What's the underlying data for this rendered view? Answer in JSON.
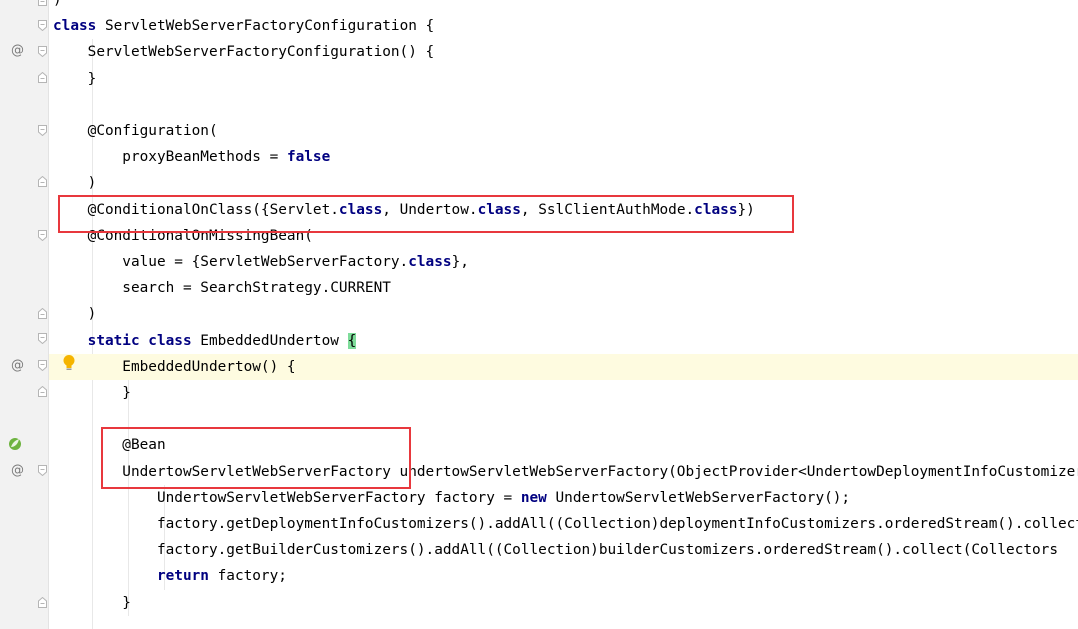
{
  "colors": {
    "keyword": "#000080",
    "highlight_box": "#e8383d",
    "current_line": "#fefbe0",
    "brace_match": "#7edc9a"
  },
  "gutter_icons": {
    "override": "@",
    "implements": "@",
    "bulb": "bulb-icon",
    "spring": "spring-bean-icon",
    "fold": "fold-icon"
  },
  "lines": [
    {
      "top_code": [
        {
          "t": ")",
          "c": "plain"
        }
      ]
    },
    {
      "code": [
        {
          "t": "class",
          "c": "kw"
        },
        {
          "t": " ServletWebServerFactoryConfiguration {",
          "c": "plain"
        }
      ]
    },
    {
      "code": [
        {
          "t": "    ServletWebServerFactoryConfiguration() {",
          "c": "plain"
        }
      ]
    },
    {
      "code": [
        {
          "t": "    }",
          "c": "plain"
        }
      ]
    },
    {
      "code": [
        {
          "t": "",
          "c": "plain"
        }
      ]
    },
    {
      "code": [
        {
          "t": "    @Configuration(",
          "c": "plain"
        }
      ]
    },
    {
      "code": [
        {
          "t": "        proxyBeanMethods = ",
          "c": "plain"
        },
        {
          "t": "false",
          "c": "kw"
        }
      ]
    },
    {
      "code": [
        {
          "t": "    )",
          "c": "plain"
        }
      ]
    },
    {
      "code": [
        {
          "t": "    @ConditionalOnClass({Servlet.",
          "c": "plain"
        },
        {
          "t": "class",
          "c": "kw"
        },
        {
          "t": ", Undertow.",
          "c": "plain"
        },
        {
          "t": "class",
          "c": "kw"
        },
        {
          "t": ", SslClientAuthMode.",
          "c": "plain"
        },
        {
          "t": "class",
          "c": "kw"
        },
        {
          "t": "})",
          "c": "plain"
        }
      ]
    },
    {
      "code": [
        {
          "t": "    @ConditionalOnMissingBean(",
          "c": "plain"
        }
      ]
    },
    {
      "code": [
        {
          "t": "        value = {ServletWebServerFactory.",
          "c": "plain"
        },
        {
          "t": "class",
          "c": "kw"
        },
        {
          "t": "},",
          "c": "plain"
        }
      ]
    },
    {
      "code": [
        {
          "t": "        search = SearchStrategy.CURRENT",
          "c": "plain"
        }
      ]
    },
    {
      "code": [
        {
          "t": "    )",
          "c": "plain"
        }
      ]
    },
    {
      "code": [
        {
          "t": "    ",
          "c": "plain"
        },
        {
          "t": "static class",
          "c": "kw"
        },
        {
          "t": " EmbeddedUndertow ",
          "c": "plain"
        },
        {
          "t": "{",
          "c": "brace"
        }
      ]
    },
    {
      "code": [
        {
          "t": "        EmbeddedUndertow() {",
          "c": "plain"
        }
      ]
    },
    {
      "code": [
        {
          "t": "        }",
          "c": "plain"
        }
      ]
    },
    {
      "code": [
        {
          "t": "",
          "c": "plain"
        }
      ]
    },
    {
      "code": [
        {
          "t": "        @Bean",
          "c": "plain"
        }
      ]
    },
    {
      "code": [
        {
          "t": "        UndertowServletWebServerFactory undertowServletWebServerFactory(ObjectProvider<UndertowDeploymentInfoCustomizer>",
          "c": "plain"
        }
      ]
    },
    {
      "code": [
        {
          "t": "            UndertowServletWebServerFactory factory = ",
          "c": "plain"
        },
        {
          "t": "new",
          "c": "kw"
        },
        {
          "t": " UndertowServletWebServerFactory();",
          "c": "plain"
        }
      ]
    },
    {
      "code": [
        {
          "t": "            factory.getDeploymentInfoCustomizers().addAll((Collection)deploymentInfoCustomizers.orderedStream().collect(",
          "c": "plain"
        }
      ]
    },
    {
      "code": [
        {
          "t": "            factory.getBuilderCustomizers().addAll((Collection)builderCustomizers.orderedStream().collect(Collectors",
          "c": "plain"
        }
      ]
    },
    {
      "code": [
        {
          "t": "            ",
          "c": "plain"
        },
        {
          "t": "return",
          "c": "kw"
        },
        {
          "t": " factory;",
          "c": "plain"
        }
      ]
    },
    {
      "code": [
        {
          "t": "        }",
          "c": "plain"
        }
      ]
    },
    {
      "code": [
        {
          "t": "",
          "c": "plain"
        }
      ]
    }
  ]
}
